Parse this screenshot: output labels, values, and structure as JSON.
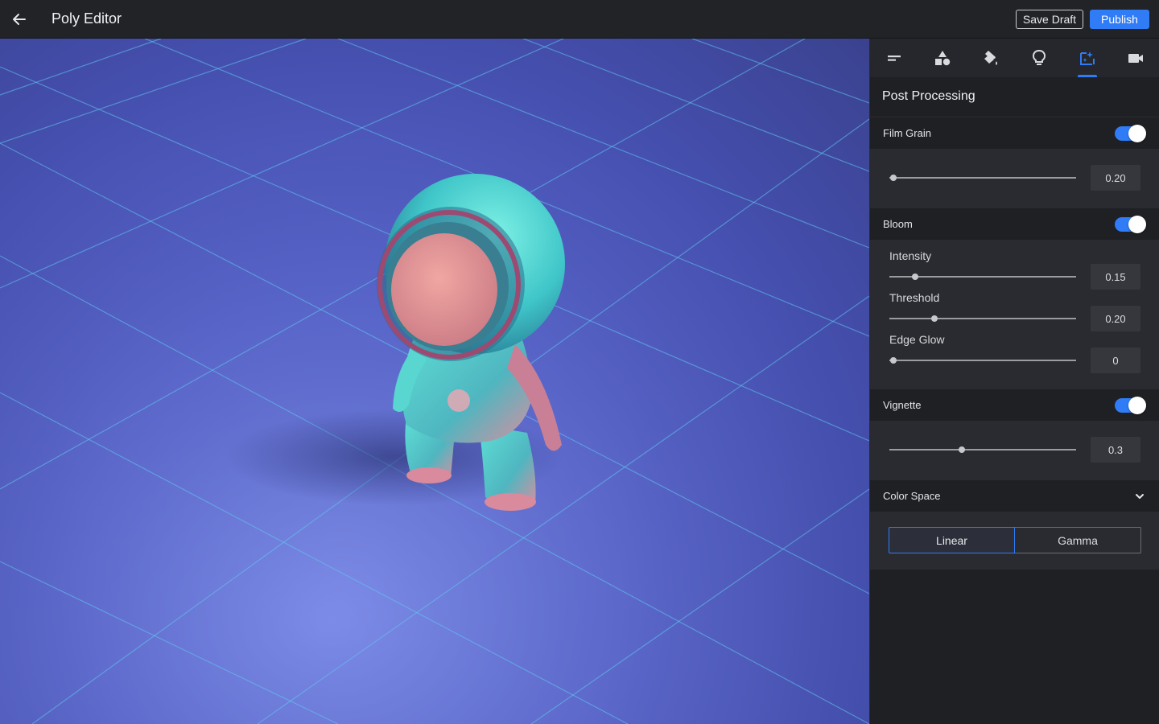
{
  "header": {
    "title": "Poly Editor",
    "save_draft_label": "Save Draft",
    "publish_label": "Publish"
  },
  "colors": {
    "accent": "#2f7cf6",
    "panel_bg": "#1f2024",
    "topbar_bg": "#222327"
  },
  "tabs": [
    {
      "icon": "sliders-icon",
      "active": false
    },
    {
      "icon": "shapes-icon",
      "active": false
    },
    {
      "icon": "paint-bucket-icon",
      "active": false
    },
    {
      "icon": "lightbulb-icon",
      "active": false
    },
    {
      "icon": "post-processing-icon",
      "active": true
    },
    {
      "icon": "camera-icon",
      "active": false
    }
  ],
  "panel": {
    "title": "Post Processing",
    "film_grain": {
      "label": "Film Grain",
      "enabled": true,
      "value": "0.20",
      "slider_fraction": 0.02
    },
    "bloom": {
      "label": "Bloom",
      "enabled": true,
      "intensity": {
        "label": "Intensity",
        "value": "0.15",
        "slider_fraction": 0.14
      },
      "threshold": {
        "label": "Threshold",
        "value": "0.20",
        "slider_fraction": 0.24
      },
      "edge_glow": {
        "label": "Edge Glow",
        "value": "0",
        "slider_fraction": 0.02
      }
    },
    "vignette": {
      "label": "Vignette",
      "enabled": true,
      "value": "0.3",
      "slider_fraction": 0.39
    },
    "color_space": {
      "label": "Color Space",
      "options": [
        "Linear",
        "Gamma"
      ],
      "selected": "Linear"
    }
  }
}
